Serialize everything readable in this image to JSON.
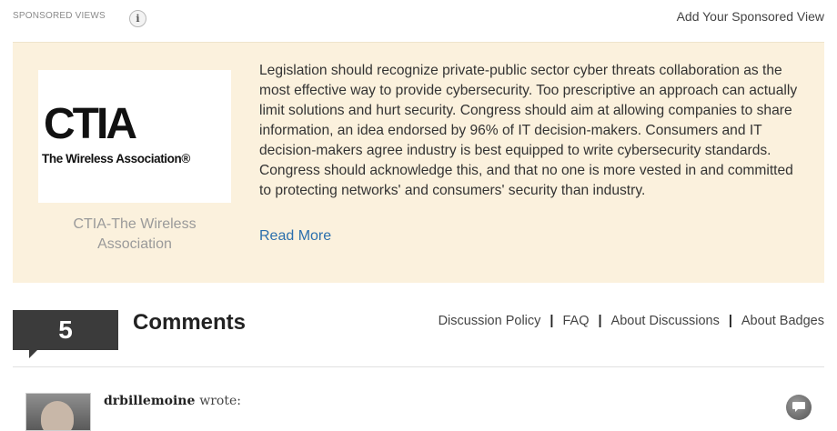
{
  "sponsored": {
    "label": "SPONSORED VIEWS",
    "info_glyph": "i",
    "add_link": "Add Your Sponsored View",
    "logo_main": "CTIA",
    "logo_sub": "The Wireless Association®",
    "sponsor_name": "CTIA-The Wireless Association",
    "text": "Legislation should recognize private-public sector cyber threats collaboration as the most effective way to provide cybersecurity. Too prescriptive an approach can actually limit solutions and hurt security. Congress should aim at allowing companies to share information, an idea endorsed by 96% of IT decision-makers. Consumers and IT decision-makers agree industry is best equipped to write cybersecurity standards. Congress should acknowledge this, and that no one is more vested in and committed to protecting networks' and consumers' security than industry.",
    "read_more": "Read More",
    "box_color": "#fbf1dd"
  },
  "comments": {
    "count": "5",
    "title": "Comments",
    "links": [
      "Discussion Policy",
      "FAQ",
      "About Discussions",
      "About Badges"
    ],
    "separator": "|",
    "first_comment": {
      "author": "drbillemoine",
      "wrote": "wrote:",
      "reply_icon": "reply-bubble-icon"
    }
  }
}
